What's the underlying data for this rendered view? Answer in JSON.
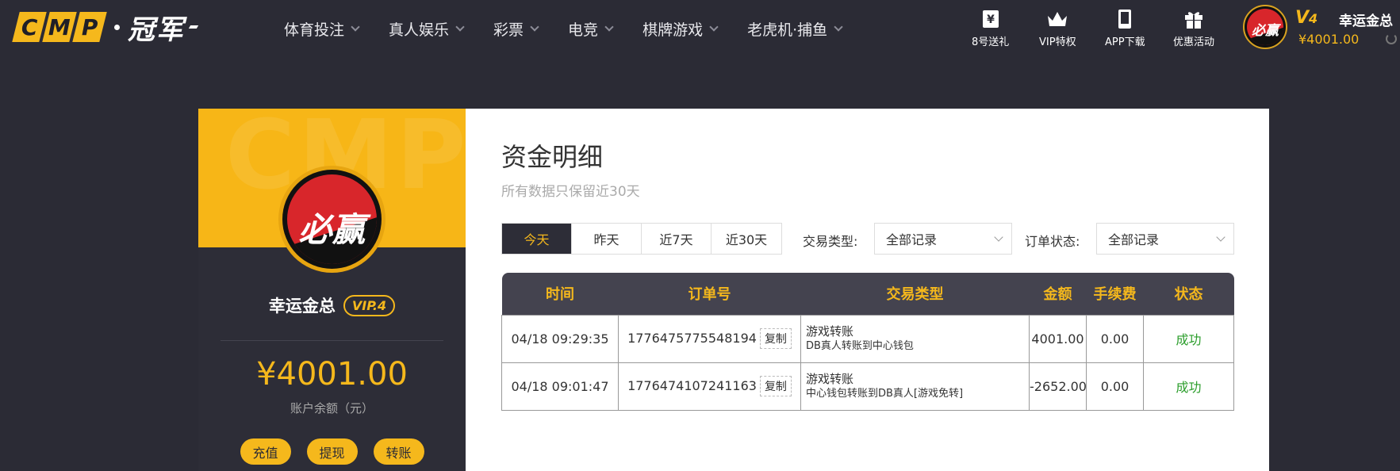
{
  "logo": {
    "letters": [
      "C",
      "M",
      "P"
    ],
    "cn": "冠军"
  },
  "nav": [
    {
      "label": "体育投注"
    },
    {
      "label": "真人娱乐"
    },
    {
      "label": "彩票"
    },
    {
      "label": "电竞"
    },
    {
      "label": "棋牌游戏"
    },
    {
      "label": "老虎机·捕鱼"
    }
  ],
  "quick_links": [
    {
      "label": "8号送礼",
      "icon": "yen-gift-icon"
    },
    {
      "label": "VIP特权",
      "icon": "crown-icon"
    },
    {
      "label": "APP下载",
      "icon": "phone-icon"
    },
    {
      "label": "优惠活动",
      "icon": "gift-box-icon"
    }
  ],
  "user": {
    "name": "幸运金总",
    "vip_level": "V",
    "vip_num": "4",
    "vip_badge": "VIP.4",
    "avatar_text": "必赢",
    "balance_top": "¥4001.00",
    "balance": "¥4001.00",
    "balance_label": "账户余额（元）"
  },
  "side": {
    "watermark": "CMP",
    "actions": [
      {
        "label": "充值"
      },
      {
        "label": "提现"
      },
      {
        "label": "转账"
      }
    ]
  },
  "page": {
    "title": "资金明细",
    "subtitle": "所有数据只保留近30天"
  },
  "tabs": [
    {
      "label": "今天",
      "active": true
    },
    {
      "label": "昨天",
      "active": false
    },
    {
      "label": "近7天",
      "active": false
    },
    {
      "label": "近30天",
      "active": false
    }
  ],
  "filters": {
    "type_label": "交易类型:",
    "type_value": "全部记录",
    "status_label": "订单状态:",
    "status_value": "全部记录"
  },
  "table": {
    "headers": [
      "时间",
      "订单号",
      "交易类型",
      "金额",
      "手续费",
      "状态"
    ],
    "copy_label": "复制",
    "rows": [
      {
        "time": "04/18 09:29:35",
        "order": "1776475775548194",
        "type_title": "游戏转账",
        "type_desc": "DB真人转账到中心钱包",
        "amount": "4001.00",
        "fee": "0.00",
        "status": "成功"
      },
      {
        "time": "04/18 09:01:47",
        "order": "1776474107241163",
        "type_title": "游戏转账",
        "type_desc": "中心钱包转账到DB真人[游戏免转]",
        "amount": "-2652.00",
        "fee": "0.00",
        "status": "成功"
      }
    ]
  },
  "colors": {
    "accent": "#f5b81c",
    "dark": "#2b2b35",
    "success": "#2a9d2a",
    "brand_red": "#d8262b"
  }
}
